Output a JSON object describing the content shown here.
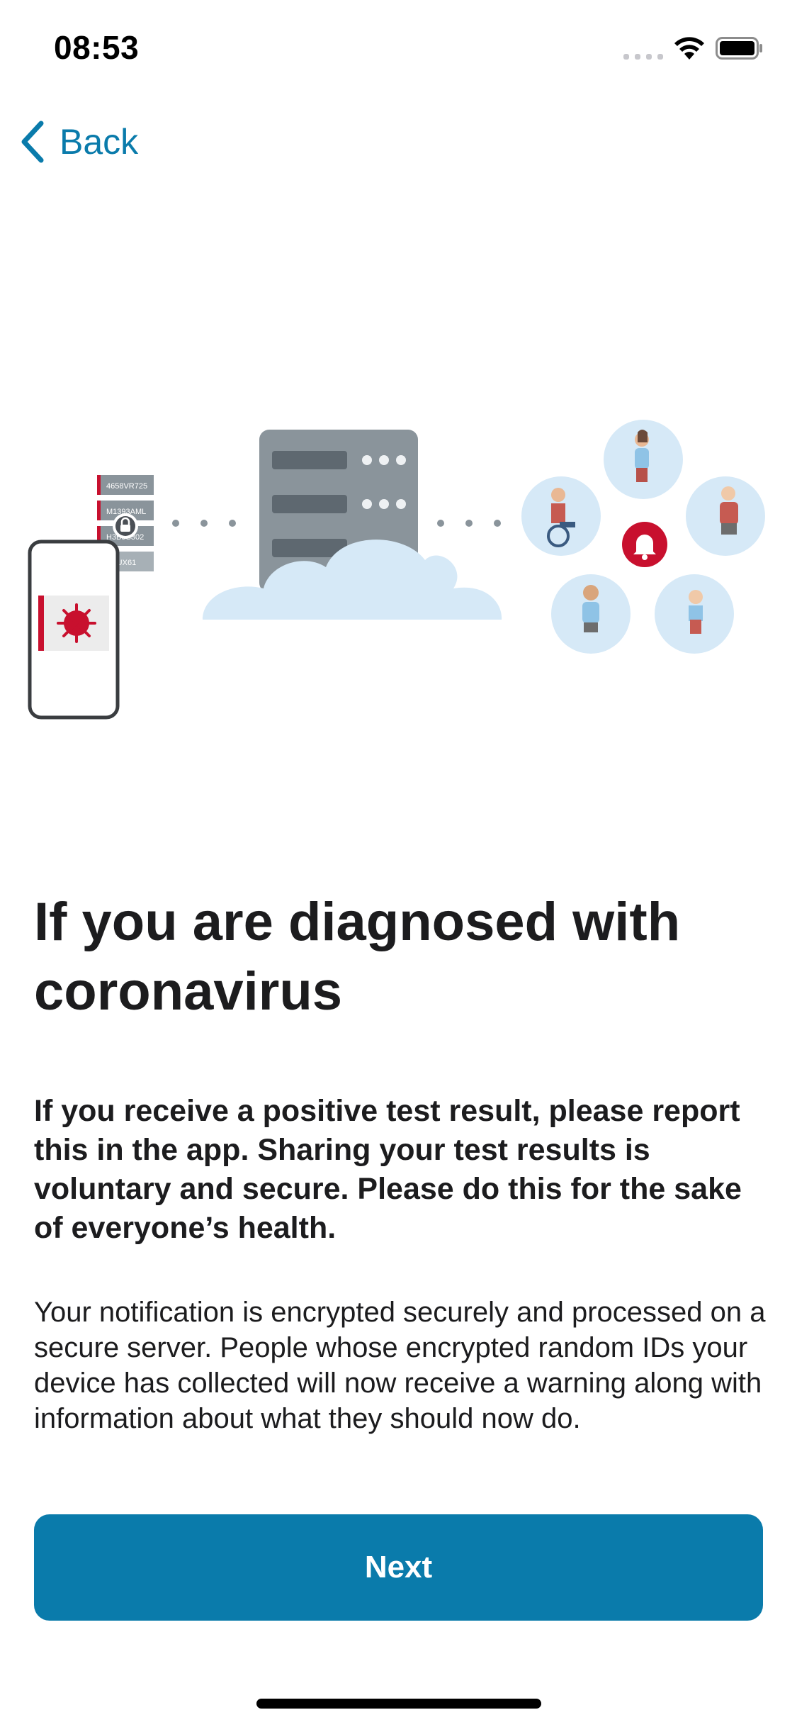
{
  "status_bar": {
    "time": "08:53"
  },
  "nav": {
    "back_label": "Back"
  },
  "illustration": {
    "id_tags": [
      "4658VR725",
      "M1393AML",
      "H3B9S302",
      "8GUX61"
    ]
  },
  "content": {
    "headline": "If you are diagnosed with coronavirus",
    "lead": "If you receive a positive test result, please report this in the app. Sharing your test results is voluntary and secure. Please do this for the sake of everyone’s health.",
    "body": "Your notification is encrypted securely and processed on a secure server. People whose encrypted random IDs your device has collected will now receive a warning along with information about what they should now do."
  },
  "actions": {
    "next_label": "Next"
  },
  "colors": {
    "accent": "#0a7bab",
    "alert": "#c8102e",
    "cloud": "#d6e9f7",
    "server": "#8a949b"
  }
}
